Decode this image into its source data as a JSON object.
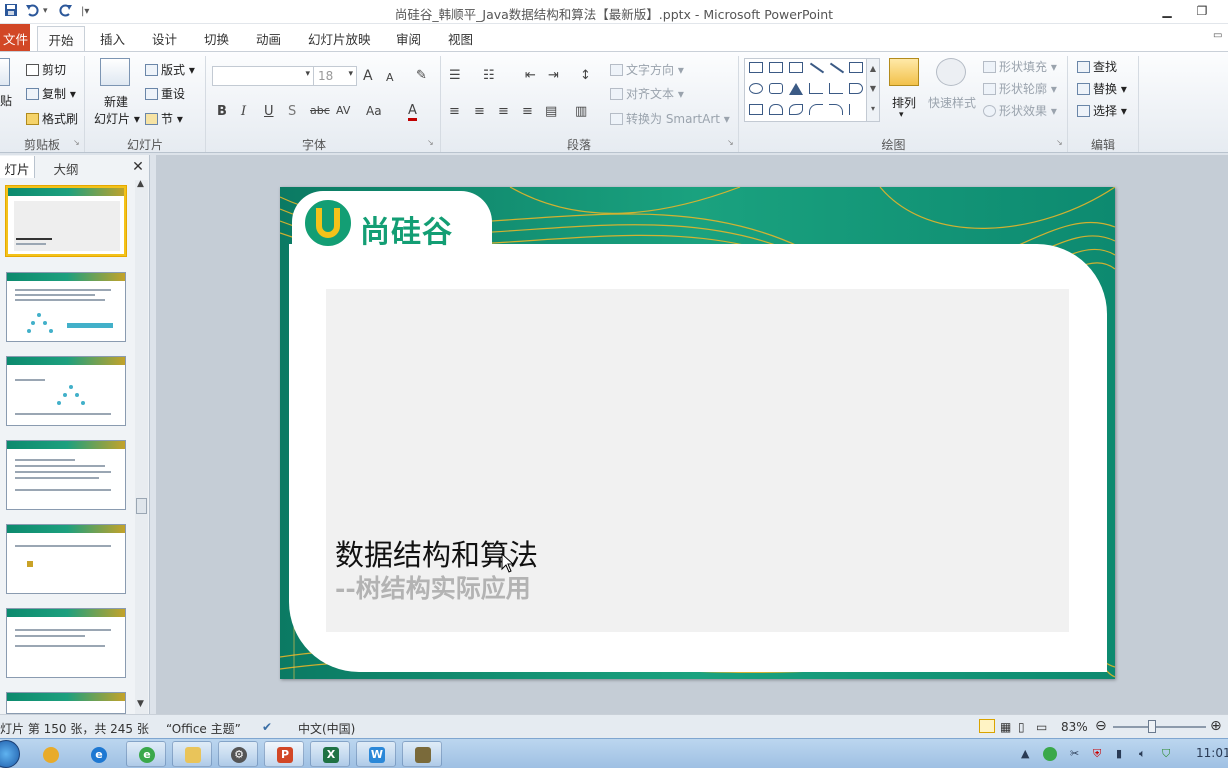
{
  "titlebar": {
    "title": "尚硅谷_韩顺平_Java数据结构和算法【最新版】.pptx - Microsoft PowerPoint",
    "qat": {
      "save_icon": "save-icon",
      "undo_icon": "undo-icon",
      "redo_icon": "redo-icon",
      "customize_icon": "customize-qat-icon"
    }
  },
  "tabs": [
    {
      "label": "文件"
    },
    {
      "label": "开始"
    },
    {
      "label": "插入"
    },
    {
      "label": "设计"
    },
    {
      "label": "切换"
    },
    {
      "label": "动画"
    },
    {
      "label": "幻灯片放映"
    },
    {
      "label": "审阅"
    },
    {
      "label": "视图"
    }
  ],
  "ribbon": {
    "clipboard": {
      "label": "剪贴板",
      "paste": "贴",
      "cut": "剪切",
      "copy": "复制",
      "format_painter": "格式刷"
    },
    "slides": {
      "label": "幻灯片",
      "new_slide_line1": "新建",
      "new_slide_line2": "幻灯片",
      "layout": "版式",
      "reset": "重设",
      "section": "节"
    },
    "font": {
      "label": "字体",
      "font_name": "",
      "font_size": "18",
      "grow": "A",
      "shrink": "A",
      "bold": "B",
      "italic": "I",
      "underline": "U",
      "shadow": "S",
      "strike": "abc",
      "spacing": "AV",
      "case": "Aa",
      "color": "A"
    },
    "paragraph": {
      "label": "段落",
      "text_direction": "文字方向",
      "align_text": "对齐文本",
      "smartart": "转换为 SmartArt"
    },
    "drawing": {
      "label": "绘图",
      "arrange": "排列",
      "quick_styles": "快速样式",
      "shape_fill": "形状填充",
      "shape_outline": "形状轮廓",
      "shape_effects": "形状效果"
    },
    "editing": {
      "label": "编辑",
      "find": "查找",
      "replace": "替换",
      "select": "选择"
    }
  },
  "panel": {
    "tab_slides": "灯片",
    "tab_outline": "大纲",
    "close_icon": "close-icon"
  },
  "slide": {
    "logo_text": "尚硅谷",
    "title": "数据结构和算法",
    "subtitle": "--树结构实际应用"
  },
  "status": {
    "slide_info": "灯片 第 150 张，共 245 张",
    "theme": "“Office 主题”",
    "language": "中文(中国)",
    "zoom": "83%"
  },
  "taskbar": {
    "clock": "11:01"
  },
  "colors": {
    "file_tab": "#d24726",
    "slide_green": "#127f6a",
    "logo_green": "#139e74",
    "selected_thumb": "#f3c21a"
  }
}
